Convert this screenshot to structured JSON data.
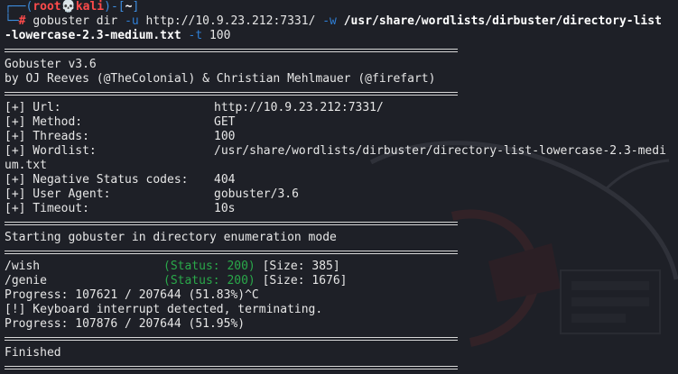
{
  "prompt": {
    "line1_prefix": "┌──(",
    "user": "root",
    "skull": "💀",
    "host": "kali",
    "line1_mid": ")-[",
    "path": "~",
    "line1_suffix": "]",
    "line2_prefix": "└─",
    "hash": "#",
    "command": "gobuster",
    "cmd_args1": " dir",
    "flag_u": " -u",
    "url_arg": " http://10.9.23.212:7331/",
    "flag_w": " -w",
    "wordlist_arg_a": " /usr/share/wordlists/dirbuster/directory-list",
    "wordlist_arg_b": "-lowercase-2.3-medium.txt",
    "flag_t": " -t",
    "threads_arg": " 100"
  },
  "banner": {
    "version": "Gobuster v3.6",
    "authors": "by OJ Reeves (@TheColonial) & Christian Mehlmauer (@firefart)"
  },
  "config": [
    {
      "key": "[+] Url:",
      "value": "http://10.9.23.212:7331/"
    },
    {
      "key": "[+] Method:",
      "value": "GET"
    },
    {
      "key": "[+] Threads:",
      "value": "100"
    },
    {
      "key": "[+] Wordlist:",
      "value": "/usr/share/wordlists/dirbuster/directory-list-lowercase-2.3-medi"
    },
    {
      "key": "um.txt",
      "value": ""
    },
    {
      "key": "[+] Negative Status codes:",
      "value": "404"
    },
    {
      "key": "[+] User Agent:",
      "value": "gobuster/3.6"
    },
    {
      "key": "[+] Timeout:",
      "value": "10s"
    }
  ],
  "start_msg": "Starting gobuster in directory enumeration mode",
  "results": [
    {
      "path": "/wish",
      "status": "(Status: 200)",
      "size": "[Size: 385]"
    },
    {
      "path": "/genie",
      "status": "(Status: 200)",
      "size": "[Size: 1676]"
    }
  ],
  "progress1": "Progress: 107621 / 207644 (51.83%)^C",
  "interrupt": "[!] Keyboard interrupt detected, terminating.",
  "progress2": "Progress: 107876 / 207644 (51.95%)",
  "finished": "Finished"
}
